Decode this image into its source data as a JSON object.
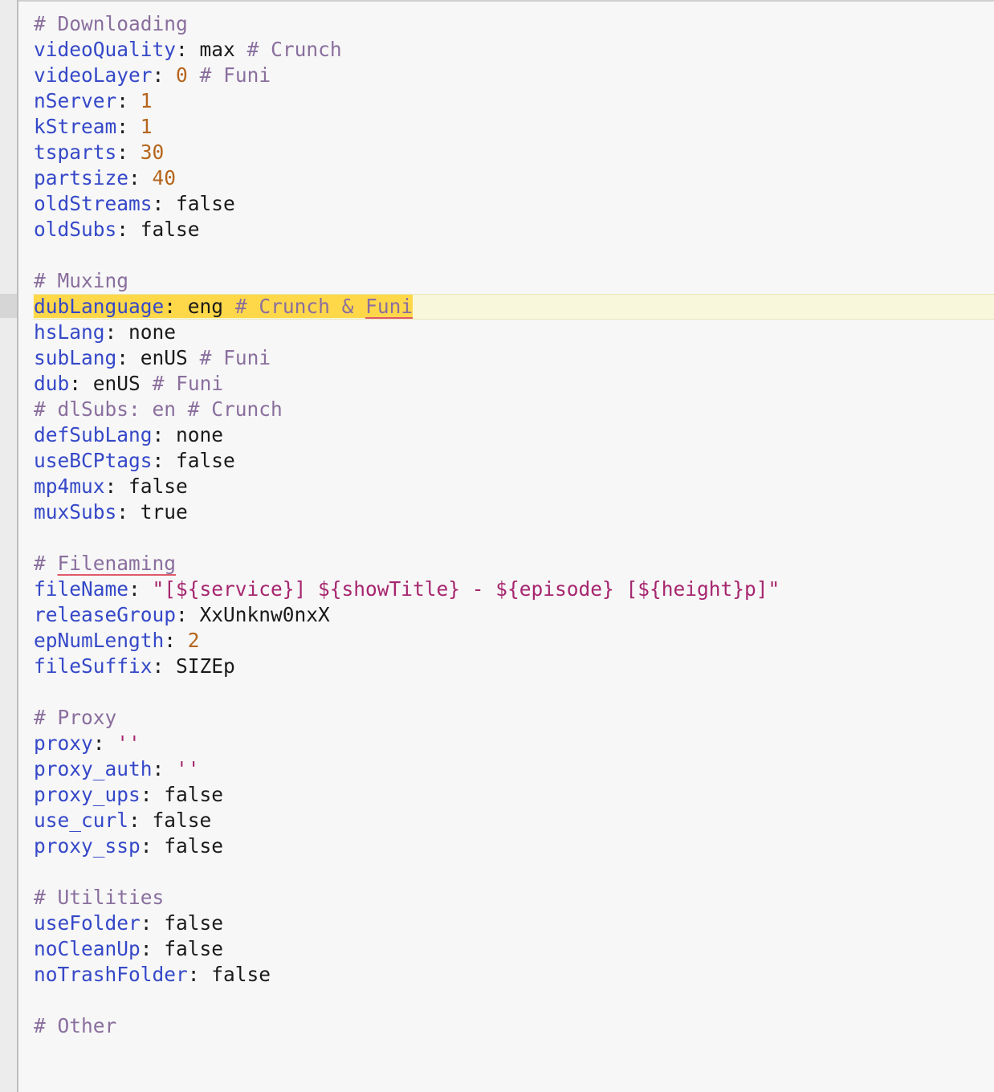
{
  "editor": {
    "current_line": 12,
    "lines": [
      {
        "type": "comment",
        "text": "# Downloading"
      },
      {
        "type": "kv",
        "key": "videoQuality",
        "value": "max",
        "vtype": "plain",
        "comment": "# Crunch"
      },
      {
        "type": "kv",
        "key": "videoLayer",
        "value": "0",
        "vtype": "number",
        "comment": "# Funi"
      },
      {
        "type": "kv",
        "key": "nServer",
        "value": "1",
        "vtype": "number"
      },
      {
        "type": "kv",
        "key": "kStream",
        "value": "1",
        "vtype": "number"
      },
      {
        "type": "kv",
        "key": "tsparts",
        "value": "30",
        "vtype": "number"
      },
      {
        "type": "kv",
        "key": "partsize",
        "value": "40",
        "vtype": "number"
      },
      {
        "type": "kv",
        "key": "oldStreams",
        "value": "false",
        "vtype": "plain"
      },
      {
        "type": "kv",
        "key": "oldSubs",
        "value": "false",
        "vtype": "plain"
      },
      {
        "type": "blank"
      },
      {
        "type": "comment",
        "text": "# Muxing"
      },
      {
        "type": "kv",
        "key": "dubLanguage",
        "value": "eng",
        "vtype": "plain",
        "comment": "# Crunch & ",
        "comment_tail": "Funi",
        "highlight": true,
        "squiggle_tail": true
      },
      {
        "type": "kv",
        "key": "hsLang",
        "value": "none",
        "vtype": "plain"
      },
      {
        "type": "kv",
        "key": "subLang",
        "value": "enUS",
        "vtype": "plain",
        "comment": "# Funi"
      },
      {
        "type": "kv",
        "key": "dub",
        "value": "enUS",
        "vtype": "plain",
        "comment": "# Funi"
      },
      {
        "type": "comment",
        "text": "# dlSubs: en # Crunch"
      },
      {
        "type": "kv",
        "key": "defSubLang",
        "value": "none",
        "vtype": "plain"
      },
      {
        "type": "kv",
        "key": "useBCPtags",
        "value": "false",
        "vtype": "plain"
      },
      {
        "type": "kv",
        "key": "mp4mux",
        "value": "false",
        "vtype": "plain"
      },
      {
        "type": "kv",
        "key": "muxSubs",
        "value": "true",
        "vtype": "plain"
      },
      {
        "type": "blank"
      },
      {
        "type": "comment",
        "text": "# ",
        "tail": "Filenaming",
        "squiggle_tail": true
      },
      {
        "type": "kv",
        "key": "fileName",
        "value": "\"[${service}] ${showTitle} - ${episode} [${height}p]\"",
        "vtype": "string"
      },
      {
        "type": "kv",
        "key": "releaseGroup",
        "value": "XxUnknw0nxX",
        "vtype": "plain"
      },
      {
        "type": "kv",
        "key": "epNumLength",
        "value": "2",
        "vtype": "number"
      },
      {
        "type": "kv",
        "key": "fileSuffix",
        "value": "SIZEp",
        "vtype": "plain"
      },
      {
        "type": "blank"
      },
      {
        "type": "comment",
        "text": "# Proxy"
      },
      {
        "type": "kv",
        "key": "proxy",
        "value": "''",
        "vtype": "string"
      },
      {
        "type": "kv",
        "key": "proxy_auth",
        "value": "''",
        "vtype": "string"
      },
      {
        "type": "kv",
        "key": "proxy_ups",
        "value": "false",
        "vtype": "plain"
      },
      {
        "type": "kv",
        "key": "use_curl",
        "value": "false",
        "vtype": "plain"
      },
      {
        "type": "kv",
        "key": "proxy_ssp",
        "value": "false",
        "vtype": "plain"
      },
      {
        "type": "blank"
      },
      {
        "type": "comment",
        "text": "# Utilities"
      },
      {
        "type": "kv",
        "key": "useFolder",
        "value": "false",
        "vtype": "plain"
      },
      {
        "type": "kv",
        "key": "noCleanUp",
        "value": "false",
        "vtype": "plain"
      },
      {
        "type": "kv",
        "key": "noTrashFolder",
        "value": "false",
        "vtype": "plain"
      },
      {
        "type": "blank"
      },
      {
        "type": "comment",
        "text": "# Other"
      }
    ]
  },
  "colors": {
    "key": "#3548c8",
    "number": "#b5651d",
    "string": "#a6266f",
    "comment": "#8a6f9e",
    "highlight": "#ffd84a",
    "current_line": "#f8f7dc",
    "spell_squiggle": "#e05a6a"
  }
}
